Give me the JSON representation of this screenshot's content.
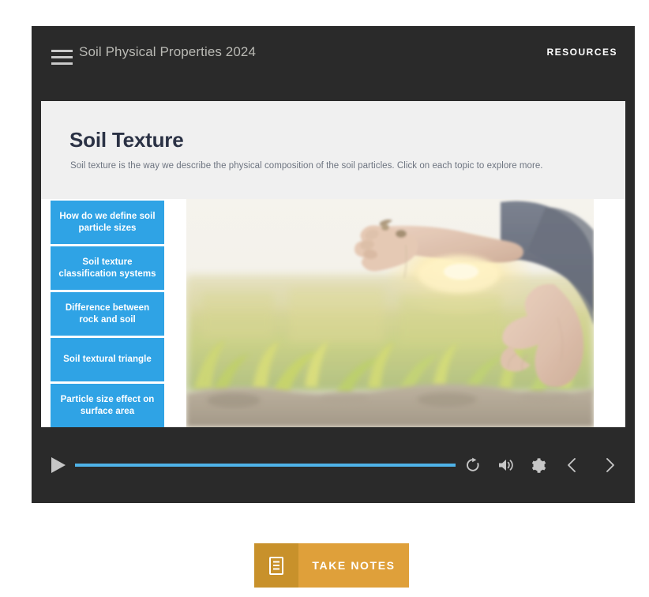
{
  "topbar": {
    "menu_icon": "hamburger-menu-icon",
    "course_title": "Soil Physical Properties 2024",
    "resources_label": "RESOURCES"
  },
  "slide": {
    "title": "Soil Texture",
    "subtitle": "Soil texture is the way we describe the physical composition of the soil particles. Click on each topic to explore more.",
    "topics": [
      {
        "label": "How do we define soil particle sizes"
      },
      {
        "label": "Soil texture classification systems"
      },
      {
        "label": "Difference between rock and soil"
      },
      {
        "label": "Soil textural triangle"
      },
      {
        "label": "Particle size effect on surface area"
      }
    ],
    "image_alt": "Farmer crouching in a field at sunset crumbling soil between fingers"
  },
  "player": {
    "play_icon": "play-icon",
    "progress_percent": 100,
    "replay_icon": "replay-icon",
    "volume_icon": "volume-icon",
    "settings_icon": "gear-icon",
    "prev_icon": "chevron-left-icon",
    "next_icon": "chevron-right-icon"
  },
  "notes": {
    "icon": "notepad-icon",
    "label": "TAKE NOTES"
  },
  "colors": {
    "shell_dark": "#2a2a2a",
    "topic_blue": "#2fa3e5",
    "progress_blue": "#4fb3e8",
    "notes_orange": "#dfa03a",
    "notes_orange_dark": "#c8912b",
    "slide_header_gray": "#f0f0f0",
    "title_navy": "#2b3245"
  }
}
